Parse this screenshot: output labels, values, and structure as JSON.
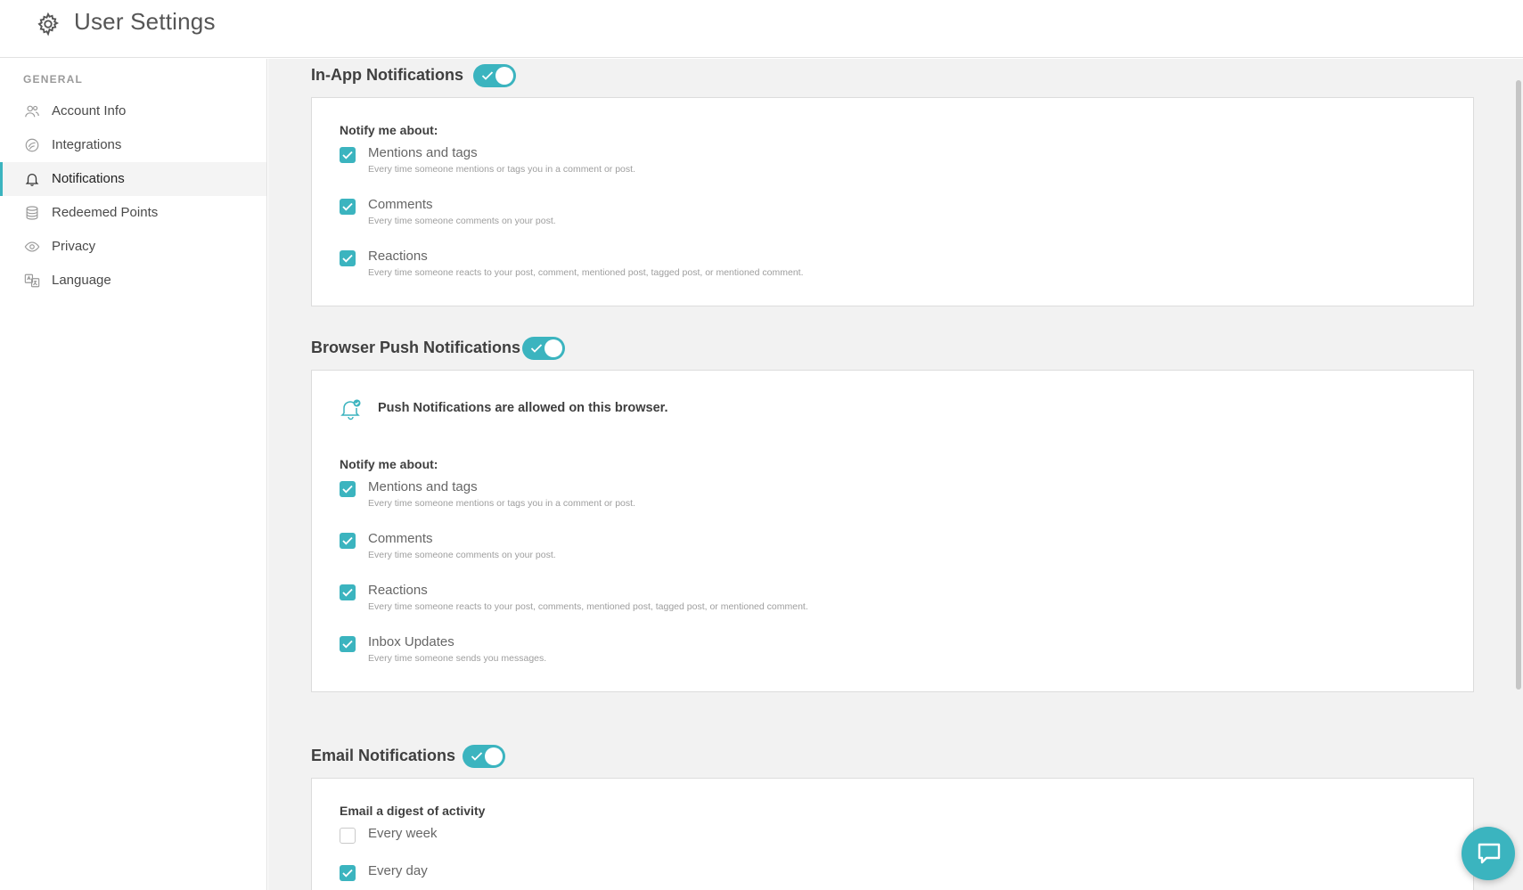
{
  "header": {
    "title": "User Settings",
    "icon": "gear-icon"
  },
  "sidebar": {
    "section_label": "GENERAL",
    "items": [
      {
        "label": "Account Info",
        "icon": "users-icon"
      },
      {
        "label": "Integrations",
        "icon": "integrations-icon"
      },
      {
        "label": "Notifications",
        "icon": "bell-icon",
        "active": true
      },
      {
        "label": "Redeemed Points",
        "icon": "database-icon"
      },
      {
        "label": "Privacy",
        "icon": "eye-icon"
      },
      {
        "label": "Language",
        "icon": "translate-icon"
      }
    ]
  },
  "in_app": {
    "title": "In-App Notifications",
    "enabled": true,
    "notify_label": "Notify me about:",
    "options": [
      {
        "title": "Mentions and tags",
        "desc": "Every time someone mentions or tags you in a comment or post.",
        "checked": true
      },
      {
        "title": "Comments",
        "desc": "Every time someone comments on your post.",
        "checked": true
      },
      {
        "title": "Reactions",
        "desc": "Every time someone reacts to your post, comment, mentioned post, tagged post, or mentioned comment.",
        "checked": true
      }
    ]
  },
  "browser_push": {
    "title": "Browser Push Notifications",
    "enabled": true,
    "status_text": "Push Notifications are allowed on this browser.",
    "notify_label": "Notify me about:",
    "options": [
      {
        "title": "Mentions and tags",
        "desc": "Every time someone mentions or tags you in a comment or post.",
        "checked": true
      },
      {
        "title": "Comments",
        "desc": "Every time someone comments on your post.",
        "checked": true
      },
      {
        "title": "Reactions",
        "desc": "Every time someone reacts to your post, comments, mentioned post, tagged post, or mentioned comment.",
        "checked": true
      },
      {
        "title": "Inbox Updates",
        "desc": "Every time someone sends you messages.",
        "checked": true
      }
    ]
  },
  "email": {
    "title": "Email Notifications",
    "enabled": true,
    "digest_label": "Email a digest of activity",
    "options": [
      {
        "title": "Every week",
        "checked": false
      },
      {
        "title": "Every day",
        "checked": true
      }
    ]
  },
  "colors": {
    "accent": "#3bb4bf",
    "background": "#f2f2f2"
  }
}
